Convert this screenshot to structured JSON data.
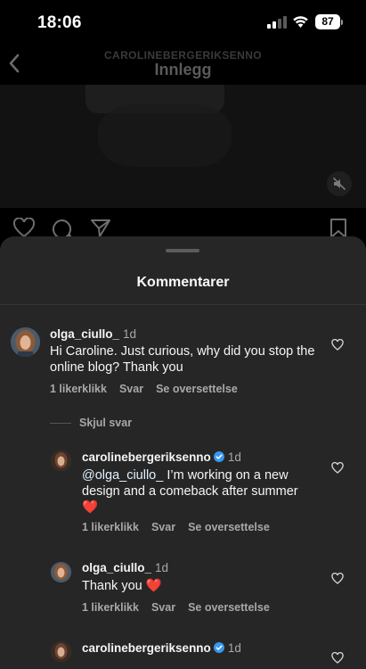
{
  "status_bar": {
    "time": "18:06",
    "battery": "87"
  },
  "header": {
    "account": "CAROLINEBERGERIKSENNO",
    "title": "Innlegg"
  },
  "sheet": {
    "title": "Kommentarer",
    "hide_replies": "Skjul svar"
  },
  "comments": [
    {
      "username": "olga_ciullo_",
      "time": "1d",
      "text": "Hi Caroline. Just curious, why did you stop the online blog? Thank you",
      "likes": "1 likerklikk",
      "reply": "Svar",
      "translate": "Se oversettelse"
    },
    {
      "username": "carolinebergeriksenno",
      "verified": true,
      "time": "1d",
      "mention": "@olga_ciullo_",
      "text": " I’m working on a new design and a comeback after summer",
      "emoji": "❤️",
      "likes": "1 likerklikk",
      "reply": "Svar",
      "translate": "Se oversettelse"
    },
    {
      "username": "olga_ciullo_",
      "time": "1d",
      "text": "Thank you",
      "emoji": "❤️",
      "likes": "1 likerklikk",
      "reply": "Svar",
      "translate": "Se oversettelse"
    },
    {
      "username": "carolinebergeriksenno",
      "verified": true,
      "time": "1d"
    }
  ],
  "colors": {
    "sheet_bg": "#262626",
    "verified_blue": "#3897f0",
    "heart_red": "#ff3040"
  },
  "icons": [
    "back-icon",
    "mute-icon",
    "heart-icon",
    "comment-icon",
    "share-icon",
    "bookmark-icon",
    "verified-icon"
  ]
}
